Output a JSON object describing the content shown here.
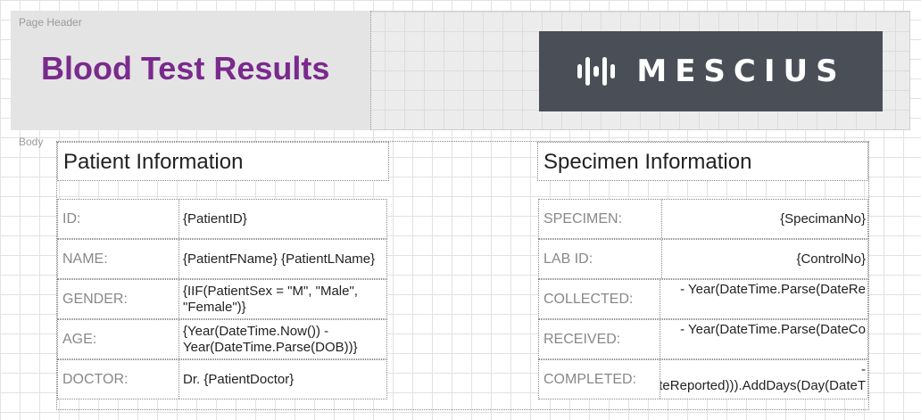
{
  "page_header": {
    "section_label": "Page Header",
    "title": "Blood Test Results",
    "logo_text": "MESCIUS"
  },
  "body": {
    "section_label": "Body",
    "patient": {
      "title": "Patient Information",
      "rows": [
        {
          "label": "ID:",
          "value": "{PatientID}"
        },
        {
          "label": "NAME:",
          "value": "{PatientFName} {PatientLName}"
        },
        {
          "label": "GENDER:",
          "value": "{IIF(PatientSex = \"M\", \"Male\", \"Female\")}"
        },
        {
          "label": "AGE:",
          "value": "{Year(DateTime.Now()) - Year(DateTime.Parse(DOB))}"
        },
        {
          "label": "DOCTOR:",
          "value": "Dr. {PatientDoctor}"
        }
      ]
    },
    "specimen": {
      "title": "Specimen Information",
      "rows": [
        {
          "label": "SPECIMEN:",
          "value": "{SpecimanNo}"
        },
        {
          "label": "LAB ID:",
          "value": "{ControlNo}"
        },
        {
          "label": "COLLECTED:",
          "value": "- Year(DateTime.Parse(DateRe"
        },
        {
          "label": "RECEIVED:",
          "value": "- Year(DateTime.Parse(DateCo"
        },
        {
          "label": "COMPLETED:",
          "value": "- Year(DateTime.Parse(DateReported))).AddDays(Day(DateT"
        }
      ]
    }
  },
  "colors": {
    "title": "#7a2a8c",
    "logo_bg": "#4a4e57"
  }
}
